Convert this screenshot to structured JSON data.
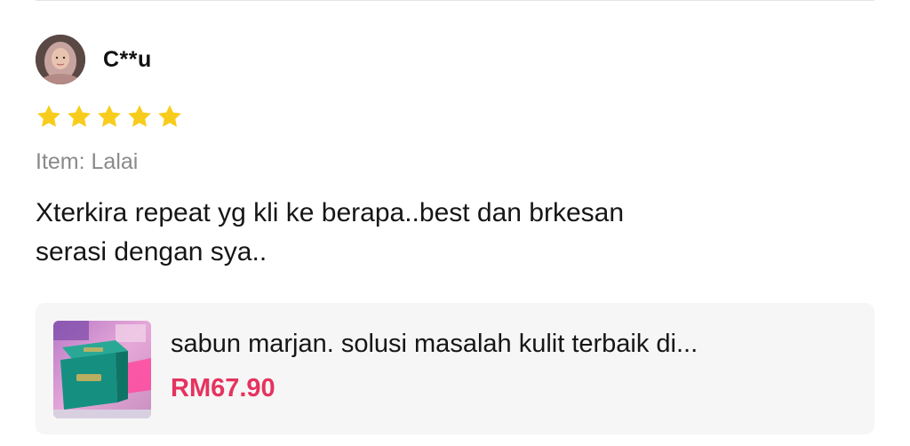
{
  "review": {
    "reviewer_name": "C**u",
    "rating": 5,
    "rating_max": 5,
    "item_variant": "Item: Lalai",
    "text_line1": "Xterkira repeat yg kli ke berapa..best dan brkesan",
    "text_line2": "serasi dengan sya.."
  },
  "product": {
    "title": "sabun marjan. solusi masalah kulit terbaik di...",
    "price": "RM67.90"
  },
  "colors": {
    "star": "#f8cc1c",
    "price": "#e5335f",
    "card_bg": "#f6f6f6",
    "muted_text": "#8a8a8a"
  },
  "icons": {
    "rating": "star-icon",
    "avatar": "user-photo",
    "thumbnail": "product-photo"
  }
}
